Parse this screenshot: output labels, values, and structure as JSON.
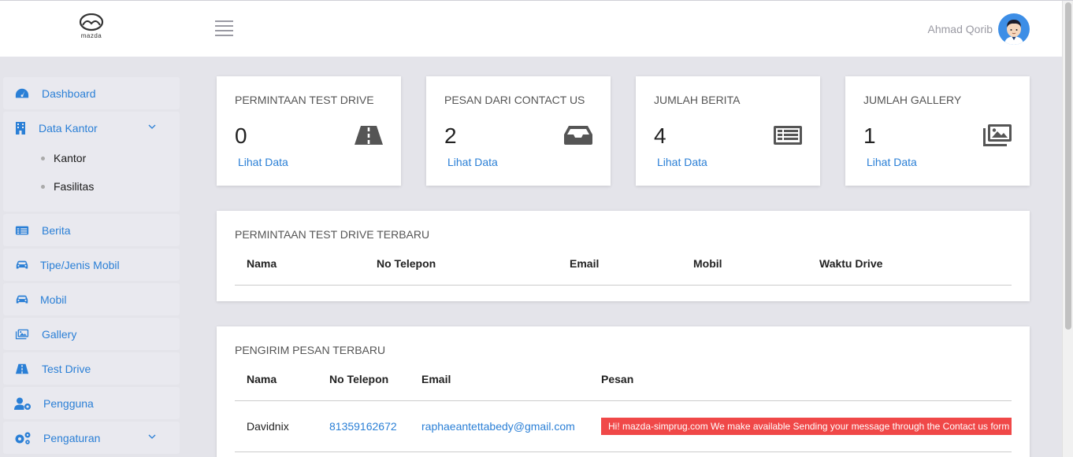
{
  "header": {
    "logo_text": "mazda",
    "user_name": "Ahmad Qorib"
  },
  "sidebar": {
    "items": [
      {
        "label": "Dashboard",
        "icon": "dashboard-icon"
      },
      {
        "label": "Data Kantor",
        "icon": "building-icon",
        "expanded": true,
        "children": [
          {
            "label": "Kantor"
          },
          {
            "label": "Fasilitas"
          }
        ]
      },
      {
        "label": "Berita",
        "icon": "newspaper-icon"
      },
      {
        "label": "Tipe/Jenis Mobil",
        "icon": "car-icon"
      },
      {
        "label": "Mobil",
        "icon": "car-icon"
      },
      {
        "label": "Gallery",
        "icon": "images-icon"
      },
      {
        "label": "Test Drive",
        "icon": "road-icon"
      },
      {
        "label": "Pengguna",
        "icon": "user-cog-icon"
      },
      {
        "label": "Pengaturan",
        "icon": "cogs-icon"
      }
    ]
  },
  "stats": [
    {
      "title": "PERMINTAAN TEST DRIVE",
      "value": "0",
      "link": "Lihat Data",
      "icon": "road-icon"
    },
    {
      "title": "PESAN DARI CONTACT US",
      "value": "2",
      "link": "Lihat Data",
      "icon": "inbox-icon"
    },
    {
      "title": "JUMLAH BERITA",
      "value": "4",
      "link": "Lihat Data",
      "icon": "newspaper-icon"
    },
    {
      "title": "JUMLAH GALLERY",
      "value": "1",
      "link": "Lihat Data",
      "icon": "images-icon"
    }
  ],
  "test_drive_panel": {
    "title": "PERMINTAAN TEST DRIVE TERBARU",
    "columns": [
      "Nama",
      "No Telepon",
      "Email",
      "Mobil",
      "Waktu Drive"
    ],
    "rows": []
  },
  "messages_panel": {
    "title": "PENGIRIM PESAN TERBARU",
    "columns": [
      "Nama",
      "No Telepon",
      "Email",
      "Pesan"
    ],
    "rows": [
      {
        "nama": "Davidnix",
        "telepon": "81359162672",
        "email": "raphaeantettabedy@gmail.com",
        "pesan": "Hi! mazda-simprug.com We make available Sending your message through the Contact us form"
      }
    ]
  },
  "colors": {
    "accent": "#2a7fd6",
    "badge": "#f04848"
  }
}
